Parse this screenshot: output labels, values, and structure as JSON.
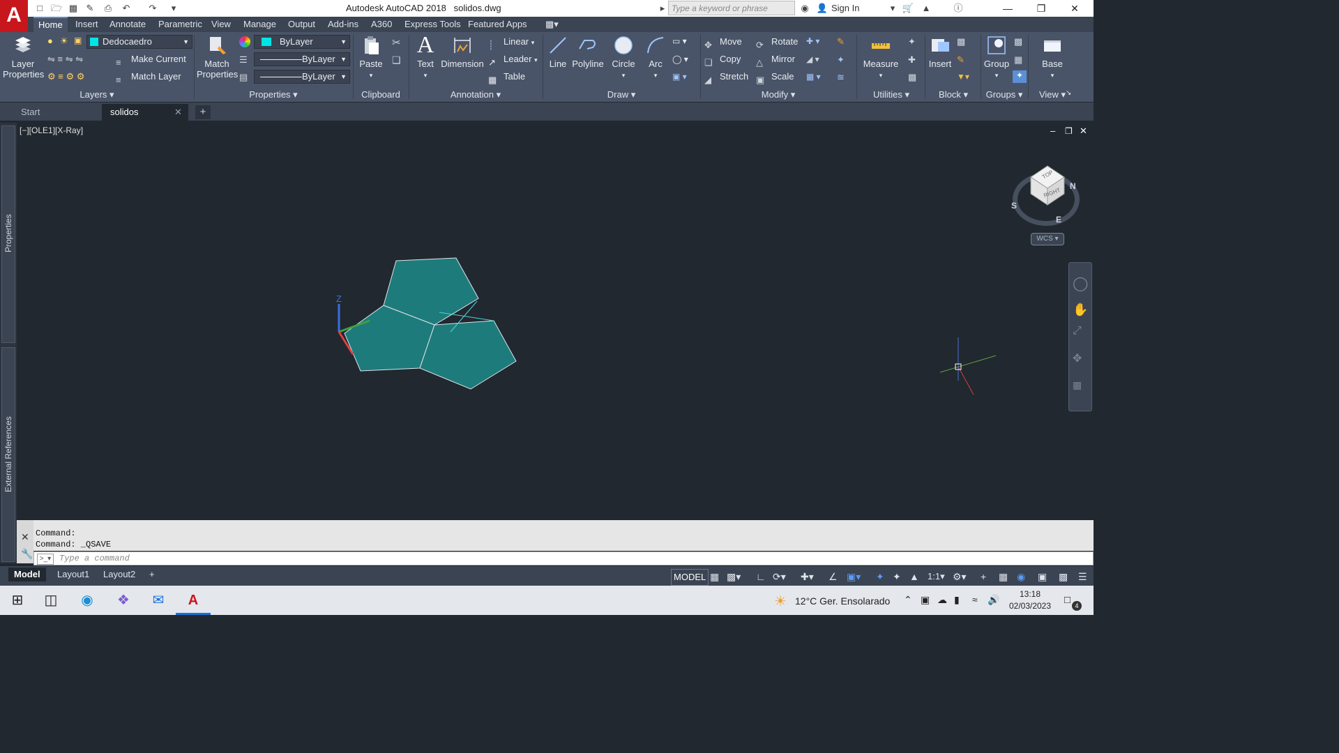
{
  "title_bar": {
    "app_name": "Autodesk AutoCAD 2018",
    "file_name": "solidos.dwg",
    "search_placeholder": "Type a keyword or phrase",
    "sign_in": "Sign In"
  },
  "ribbon_tabs": [
    "Home",
    "Insert",
    "Annotate",
    "Parametric",
    "View",
    "Manage",
    "Output",
    "Add-ins",
    "A360",
    "Express Tools",
    "Featured Apps"
  ],
  "layers": {
    "layer_properties": "Layer Properties",
    "current_layer": "Dedocaedro",
    "make_current": "Make Current",
    "match_layer": "Match Layer",
    "title": "Layers"
  },
  "properties": {
    "match_properties": "Match Properties",
    "color": "ByLayer",
    "linetype": "ByLayer",
    "lineweight": "ByLayer",
    "title": "Properties"
  },
  "clipboard": {
    "paste": "Paste",
    "title": "Clipboard"
  },
  "annotation": {
    "text": "Text",
    "dimension": "Dimension",
    "linear": "Linear",
    "leader": "Leader",
    "table": "Table",
    "title": "Annotation"
  },
  "draw": {
    "line": "Line",
    "polyline": "Polyline",
    "circle": "Circle",
    "arc": "Arc",
    "title": "Draw"
  },
  "modify": {
    "move": "Move",
    "rotate": "Rotate",
    "copy": "Copy",
    "mirror": "Mirror",
    "stretch": "Stretch",
    "scale": "Scale",
    "title": "Modify"
  },
  "utilities": {
    "measure": "Measure",
    "title": "Utilities"
  },
  "block": {
    "insert": "Insert",
    "title": "Block"
  },
  "groups": {
    "group": "Group",
    "title": "Groups"
  },
  "view_panel": {
    "base": "Base",
    "title": "View"
  },
  "doc_tabs": [
    "Start",
    "solidos"
  ],
  "viewport": {
    "label": "[−][OLE1][X-Ray]",
    "viewcube_top": "TOP",
    "viewcube_right": "RIGHT",
    "compass": {
      "n": "N",
      "s": "S",
      "e": "E"
    },
    "wcs": "WCS",
    "axis_z": "Z"
  },
  "side_palettes": {
    "properties": "Properties",
    "external_references": "External References"
  },
  "command": {
    "history": [
      "Command:",
      "Command: _QSAVE"
    ],
    "placeholder": "Type a command"
  },
  "layout_tabs": [
    "Model",
    "Layout1",
    "Layout2"
  ],
  "status": {
    "model": "MODEL",
    "scale": "1:1"
  },
  "taskbar": {
    "weather": "12°C  Ger. Ensolarado",
    "time": "13:18",
    "date": "02/03/2023",
    "notifications": "4"
  },
  "colors": {
    "accent": "#c8161d",
    "ribbon": "#4a5468",
    "viewport": "#212830",
    "solid_fill": "#1e7b7b"
  }
}
